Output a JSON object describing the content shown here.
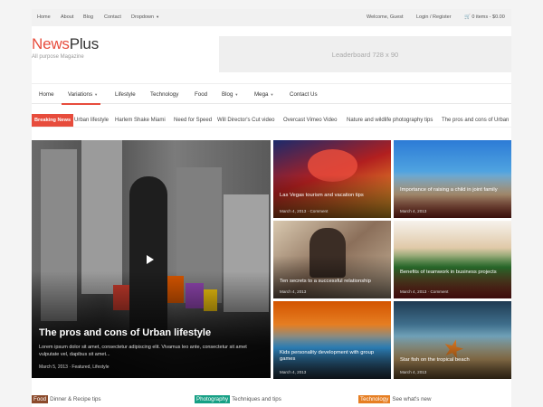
{
  "topbar": {
    "links": [
      "Home",
      "About",
      "Blog",
      "Contact"
    ],
    "dropdown_label": "Dropdown",
    "welcome": "Welcome, Guest",
    "login": "Login / Register",
    "cart": "0 items - $0.00"
  },
  "brand": {
    "logo_part1": "News",
    "logo_part2": "Plus",
    "tagline": "All purpose Magazine"
  },
  "ad": {
    "label": "Leaderboard 728 x 90"
  },
  "nav": {
    "items": [
      "Home",
      "Variations",
      "Lifestyle",
      "Technology",
      "Food",
      "Blog",
      "Mega",
      "Contact Us"
    ],
    "active": "Variations"
  },
  "ticker": {
    "label": "Breaking News",
    "items": [
      "Urban lifestyle",
      "Harlem Shake Miami",
      "Need for Speed",
      "Will Director's Cut video",
      "Overcast Vimeo Video",
      "Nature and wildlife photography tips",
      "The pros and cons of Urban"
    ]
  },
  "featured": {
    "title": "The pros and cons of Urban lifestyle",
    "excerpt": "Lorem ipsum dolor sit amet, consectetur adipiscing elit. Vivamus leo ante, consectetur sit amet vulputate vel, dapibus sit amet...",
    "meta": "March 5, 2013 · Featured, Lifestyle"
  },
  "tiles": [
    {
      "title": "Las Vegas tourism and vacation tips",
      "date": "March 4, 2013",
      "comment": "Comment"
    },
    {
      "title": "Importance of raising a child in joint family",
      "date": "March 4, 2013",
      "comment": "Comment"
    },
    {
      "title": "Ten secrets to a successful relationship",
      "date": "March 4, 2013",
      "comment": "Comment"
    },
    {
      "title": "Benefits of teamwork in business projects",
      "date": "March 4, 2013",
      "comment": "Comment"
    },
    {
      "title": "Kids personality development with group games",
      "date": "March 4, 2013",
      "comment": "Comment"
    },
    {
      "title": "Star fish on the tropical beach",
      "date": "March 4, 2013",
      "comment": "Comment"
    }
  ],
  "categories": [
    {
      "tag": "Food",
      "text": "Dinner & Recipe tips",
      "color": "#8b4a2b"
    },
    {
      "tag": "Photography",
      "text": "Techniques and tips",
      "color": "#16a085"
    },
    {
      "tag": "Technology",
      "text": "See what's new",
      "color": "#e67e22"
    }
  ],
  "colors": {
    "accent": "#e74c3c"
  }
}
